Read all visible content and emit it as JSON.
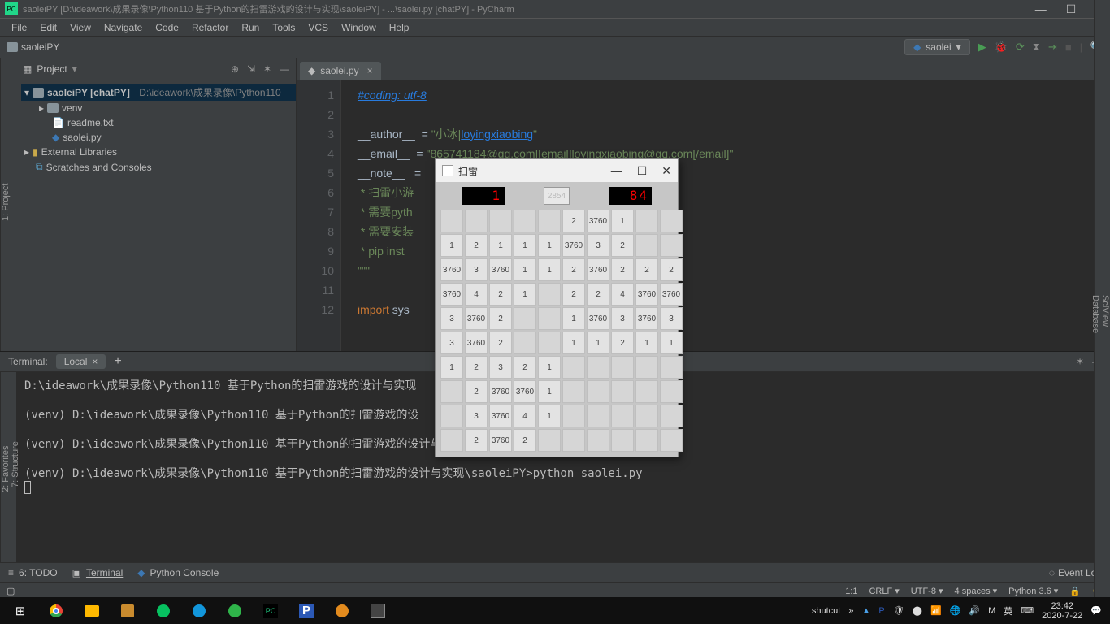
{
  "os_title": "saoleiPY [D:\\ideawork\\成果录像\\Python110 基于Python的扫雷游戏的设计与实现\\saoleiPY] - ...\\saolei.py [chatPY] - PyCharm",
  "menubar": {
    "items": [
      "File",
      "Edit",
      "View",
      "Navigate",
      "Code",
      "Refactor",
      "Run",
      "Tools",
      "VCS",
      "Window",
      "Help"
    ]
  },
  "breadcrumb": {
    "project": "saoleiPY"
  },
  "runconf": {
    "name": "saolei"
  },
  "project_panel": {
    "title": "Project",
    "root": "saoleiPY [chatPY]",
    "root_path": "D:\\ideawork\\成果录像\\Python110",
    "children": [
      "venv",
      "readme.txt",
      "saolei.py"
    ],
    "external": "External Libraries",
    "scratches": "Scratches and Consoles"
  },
  "editor": {
    "tab": "saolei.py",
    "line_count": 12,
    "lines": {
      "l1": "#coding: utf-8",
      "l3a": "__author__ ",
      "l3b": " = ",
      "l3c": "\"小冰|",
      "l3d": "loyingxiaobing",
      "l3e": "\"",
      "l4a": "__email__  ",
      "l4b": "= ",
      "l4c": "\"865741184@qq.com|[email]loyingxiaobing@qq.com[/email]\"",
      "l5a": "__note__  ",
      "l5b": " = ",
      "l6": " * 扫雷小游",
      "l7": " * 需要pyth",
      "l8": " * 需要安装",
      "l9": " * pip inst",
      "l10": "\"\"\"",
      "l12a": "import",
      "l12b": " sys"
    }
  },
  "terminal": {
    "label": "Terminal:",
    "tab": "Local",
    "lines": [
      "D:\\ideawork\\成果录像\\Python110 基于Python的扫雷游戏的设计与实现",
      "",
      "(venv) D:\\ideawork\\成果录像\\Python110 基于Python的扫雷游戏的设",
      "",
      "(venv) D:\\ideawork\\成果录像\\Python110 基于Python的扫雷游戏的设计与实现\\saoleiPY>python saolei.py",
      "",
      "(venv) D:\\ideawork\\成果录像\\Python110 基于Python的扫雷游戏的设计与实现\\saoleiPY>python saolei.py"
    ]
  },
  "bottom_tabs": {
    "todo": "6: TODO",
    "terminal": "Terminal",
    "pyconsole": "Python Console",
    "eventlog": "Event Log"
  },
  "statusbar": {
    "pos": "1:1",
    "eol": "CRLF",
    "enc": "UTF-8",
    "indent": "4 spaces",
    "py": "Python 3.6"
  },
  "mines": {
    "title": "扫雷",
    "flags": "1",
    "face": "2854",
    "timer": "84",
    "grid": [
      [
        "",
        "",
        "",
        "",
        "",
        "2",
        "3760",
        "1",
        "",
        ""
      ],
      [
        "1",
        "2",
        "1",
        "1",
        "1",
        "3760",
        "3",
        "2",
        "",
        ""
      ],
      [
        "3760",
        "3",
        "3760",
        "1",
        "1",
        "2",
        "3760",
        "2",
        "2",
        "2"
      ],
      [
        "3760",
        "4",
        "2",
        "1",
        "",
        "2",
        "2",
        "4",
        "3760",
        "3760"
      ],
      [
        "3",
        "3760",
        "2",
        "",
        "",
        "1",
        "3760",
        "3",
        "3760",
        "3"
      ],
      [
        "3",
        "3760",
        "2",
        "",
        "",
        "1",
        "1",
        "2",
        "1",
        "1"
      ],
      [
        "1",
        "2",
        "3",
        "2",
        "1",
        "",
        "",
        "",
        "",
        ""
      ],
      [
        "",
        "2",
        "3760",
        "3760",
        "1",
        "",
        "",
        "",
        "",
        ""
      ],
      [
        "",
        "3",
        "3760",
        "4",
        "1",
        "",
        "",
        "",
        "",
        ""
      ],
      [
        "",
        "2",
        "3760",
        "2",
        "",
        "",
        "",
        "",
        "",
        ""
      ]
    ]
  },
  "left_tabs": {
    "project": "1: Project",
    "structure": "7: Structure",
    "favorites": "2: Favorites"
  },
  "right_tabs": {
    "sciview": "SciView",
    "database": "Database"
  },
  "taskbar": {
    "shortcut": "shutcut",
    "time": "23:42",
    "date": "2020-7-22",
    "ime": "英"
  }
}
